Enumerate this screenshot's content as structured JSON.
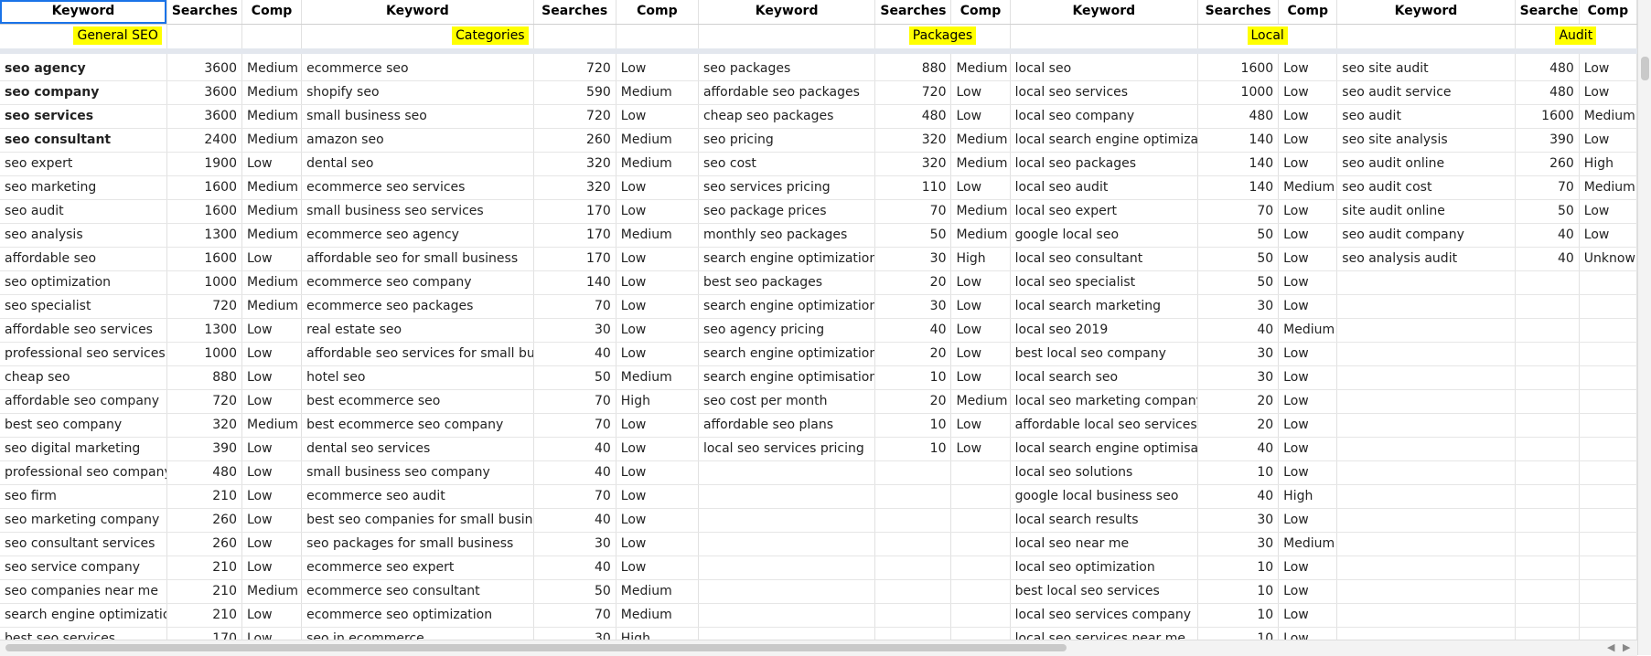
{
  "headers": [
    "Keyword",
    "Searches",
    "Comp",
    "Keyword",
    "Searches",
    "Comp",
    "Keyword",
    "Searches",
    "Comp",
    "Keyword",
    "Searches",
    "Comp",
    "Keyword",
    "Searches",
    "Comp"
  ],
  "categories": [
    "General SEO",
    "Categories",
    "Packages",
    "Local",
    "Audit"
  ],
  "rows": [
    [
      "seo agency",
      "3600",
      "Medium",
      "ecommerce seo",
      "720",
      "Low",
      "seo packages",
      "880",
      "Medium",
      "local seo",
      "1600",
      "Low",
      "seo site audit",
      "480",
      "Low"
    ],
    [
      "seo company",
      "3600",
      "Medium",
      "shopify seo",
      "590",
      "Medium",
      "affordable seo packages",
      "720",
      "Low",
      "local seo services",
      "1000",
      "Low",
      "seo audit service",
      "480",
      "Low"
    ],
    [
      "seo services",
      "3600",
      "Medium",
      "small business seo",
      "720",
      "Low",
      "cheap seo packages",
      "480",
      "Low",
      "local seo company",
      "480",
      "Low",
      "seo audit",
      "1600",
      "Medium"
    ],
    [
      "seo consultant",
      "2400",
      "Medium",
      "amazon seo",
      "260",
      "Medium",
      "seo pricing",
      "320",
      "Medium",
      "local search engine optimization",
      "140",
      "Low",
      "seo site analysis",
      "390",
      "Low"
    ],
    [
      "seo expert",
      "1900",
      "Low",
      "dental seo",
      "320",
      "Medium",
      "seo cost",
      "320",
      "Medium",
      "local seo packages",
      "140",
      "Low",
      "seo audit online",
      "260",
      "High"
    ],
    [
      "seo marketing",
      "1600",
      "Medium",
      "ecommerce seo services",
      "320",
      "Low",
      "seo services pricing",
      "110",
      "Low",
      "local seo audit",
      "140",
      "Medium",
      "seo audit cost",
      "70",
      "Medium"
    ],
    [
      "seo audit",
      "1600",
      "Medium",
      "small business seo services",
      "170",
      "Low",
      "seo package prices",
      "70",
      "Medium",
      "local seo expert",
      "70",
      "Low",
      "site audit online",
      "50",
      "Low"
    ],
    [
      "seo analysis",
      "1300",
      "Medium",
      "ecommerce seo agency",
      "170",
      "Medium",
      "monthly seo packages",
      "50",
      "Medium",
      "google local seo",
      "50",
      "Low",
      "seo audit company",
      "40",
      "Low"
    ],
    [
      "affordable seo",
      "1600",
      "Low",
      "affordable seo for small business",
      "170",
      "Low",
      "search engine optimization c",
      "30",
      "High",
      "local seo consultant",
      "50",
      "Low",
      "seo analysis audit",
      "40",
      "Unknown"
    ],
    [
      "seo optimization",
      "1000",
      "Medium",
      "ecommerce seo company",
      "140",
      "Low",
      "best seo packages",
      "20",
      "Low",
      "local seo specialist",
      "50",
      "Low",
      "",
      "",
      ""
    ],
    [
      "seo specialist",
      "720",
      "Medium",
      "ecommerce seo packages",
      "70",
      "Low",
      "search engine optimization p",
      "30",
      "Low",
      "local search marketing",
      "30",
      "Low",
      "",
      "",
      ""
    ],
    [
      "affordable seo services",
      "1300",
      "Low",
      "real estate seo",
      "30",
      "Low",
      "seo agency pricing",
      "40",
      "Low",
      "local seo 2019",
      "40",
      "Medium",
      "",
      "",
      ""
    ],
    [
      "professional seo services",
      "1000",
      "Low",
      "affordable seo services for small business",
      "40",
      "Low",
      "search engine optimization p",
      "20",
      "Low",
      "best local seo company",
      "30",
      "Low",
      "",
      "",
      ""
    ],
    [
      "cheap seo",
      "880",
      "Low",
      "hotel seo",
      "50",
      "Medium",
      "search engine optimisation p",
      "10",
      "Low",
      "local search seo",
      "30",
      "Low",
      "",
      "",
      ""
    ],
    [
      "affordable seo company",
      "720",
      "Low",
      "best ecommerce seo",
      "70",
      "High",
      "seo cost per month",
      "20",
      "Medium",
      "local seo marketing company",
      "20",
      "Low",
      "",
      "",
      ""
    ],
    [
      "best seo company",
      "320",
      "Medium",
      "best ecommerce seo company",
      "70",
      "Low",
      "affordable seo plans",
      "10",
      "Low",
      "affordable local seo services",
      "20",
      "Low",
      "",
      "",
      ""
    ],
    [
      "seo digital marketing",
      "390",
      "Low",
      "dental seo services",
      "40",
      "Low",
      "local seo services pricing",
      "10",
      "Low",
      "local search engine optimisation",
      "40",
      "Low",
      "",
      "",
      ""
    ],
    [
      "professional seo company",
      "480",
      "Low",
      "small business seo company",
      "40",
      "Low",
      "",
      "",
      "",
      "local seo solutions",
      "10",
      "Low",
      "",
      "",
      ""
    ],
    [
      "seo firm",
      "210",
      "Low",
      "ecommerce seo audit",
      "70",
      "Low",
      "",
      "",
      "",
      "google local business seo",
      "40",
      "High",
      "",
      "",
      ""
    ],
    [
      "seo marketing company",
      "260",
      "Low",
      "best seo companies for small business",
      "40",
      "Low",
      "",
      "",
      "",
      "local search results",
      "30",
      "Low",
      "",
      "",
      ""
    ],
    [
      "seo consultant services",
      "260",
      "Low",
      "seo packages for small business",
      "30",
      "Low",
      "",
      "",
      "",
      "local seo near me",
      "30",
      "Medium",
      "",
      "",
      ""
    ],
    [
      "seo service company",
      "210",
      "Low",
      "ecommerce seo expert",
      "40",
      "Low",
      "",
      "",
      "",
      "local seo optimization",
      "10",
      "Low",
      "",
      "",
      ""
    ],
    [
      "seo companies near me",
      "210",
      "Medium",
      "ecommerce seo consultant",
      "50",
      "Medium",
      "",
      "",
      "",
      "best local seo services",
      "10",
      "Low",
      "",
      "",
      ""
    ],
    [
      "search engine optimization",
      "210",
      "Low",
      "ecommerce seo optimization",
      "70",
      "Medium",
      "",
      "",
      "",
      "local seo services company",
      "10",
      "Low",
      "",
      "",
      ""
    ],
    [
      "best seo services",
      "170",
      "Low",
      "seo in ecommerce",
      "30",
      "High",
      "",
      "",
      "",
      "local seo services near me",
      "10",
      "Low",
      "",
      "",
      ""
    ]
  ],
  "bold_rows": [
    0,
    1,
    2,
    3
  ],
  "icons": {
    "scroll_left": "arrow-left-icon",
    "scroll_right": "arrow-right-icon"
  },
  "colors": {
    "highlight": "#ffff00",
    "selection": "#1a73e8"
  }
}
